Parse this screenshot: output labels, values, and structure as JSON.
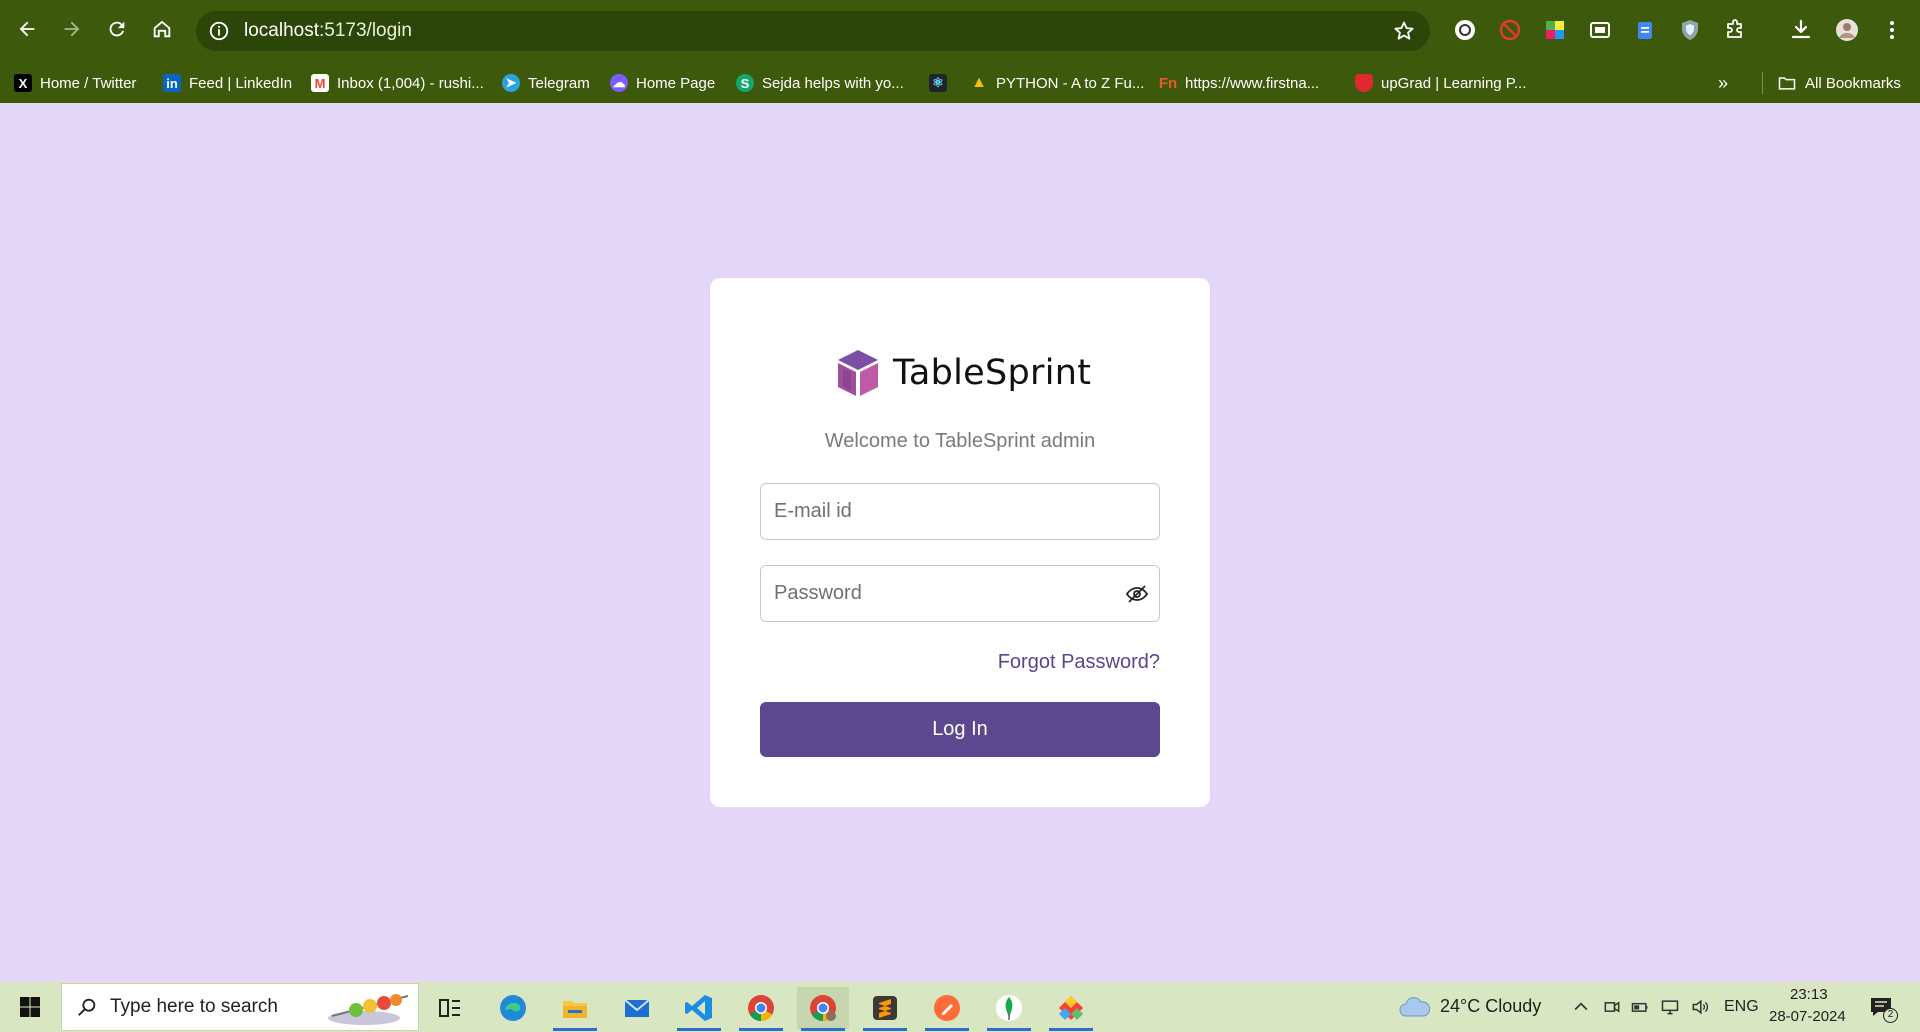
{
  "browser": {
    "url_host": "localhost",
    "url_path": ":5173/login",
    "bookmarks": [
      {
        "label": "Home / Twitter",
        "icon": "x-twitter-icon",
        "color": "#000000"
      },
      {
        "label": "Feed | LinkedIn",
        "icon": "linkedin-icon",
        "color": "#0a66c2"
      },
      {
        "label": "Inbox (1,004) - rushi...",
        "icon": "gmail-icon",
        "color": "#ea4335"
      },
      {
        "label": "Telegram",
        "icon": "telegram-icon",
        "color": "#2aa3df"
      },
      {
        "label": "Home Page",
        "icon": "cloud-icon",
        "color": "#7b5cff"
      },
      {
        "label": "Sejda helps with yo...",
        "icon": "sejda-icon",
        "color": "#14a86b"
      },
      {
        "label": "",
        "icon": "react-icon",
        "color": "#61dafb"
      },
      {
        "label": "PYTHON - A to Z Fu...",
        "icon": "google-drive-icon",
        "color": "#fbbc04"
      },
      {
        "label": "https://www.firstna...",
        "icon": "fn-icon",
        "color": "#e85a2c"
      },
      {
        "label": "upGrad | Learning P...",
        "icon": "upgrad-icon",
        "color": "#e0292f"
      }
    ],
    "all_bookmarks_label": "All Bookmarks"
  },
  "login": {
    "brand_name": "TableSprint",
    "welcome": "Welcome to TableSprint admin",
    "email_placeholder": "E-mail id",
    "password_placeholder": "Password",
    "forgot_label": "Forgot Password?",
    "login_label": "Log In",
    "accent_color": "#5c488f",
    "background_color": "#e4d6f7"
  },
  "taskbar": {
    "search_placeholder": "Type here to search",
    "weather": "24°C  Cloudy",
    "language": "ENG",
    "time": "23:13",
    "date": "28-07-2024",
    "notifications": "2",
    "apps": [
      "task-view-icon",
      "edge-icon",
      "file-explorer-icon",
      "mail-icon",
      "vscode-icon",
      "chrome-icon",
      "chrome-profile-icon",
      "sublime-icon",
      "postman-icon",
      "mongodb-icon",
      "git-icon"
    ]
  }
}
